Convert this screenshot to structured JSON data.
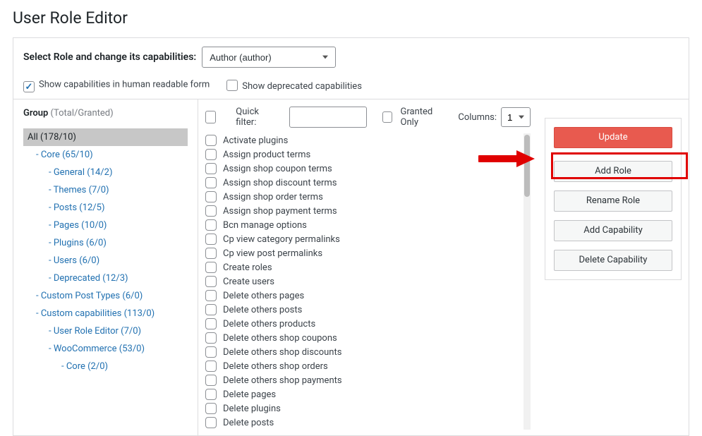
{
  "title": "User Role Editor",
  "topbar": {
    "select_label": "Select Role and change its capabilities:",
    "role_value": "Author (author)",
    "show_human": "Show capabilities in human readable form",
    "show_deprecated": "Show deprecated capabilities"
  },
  "group": {
    "heading": "Group",
    "counts_label": "(Total/Granted)",
    "items": [
      {
        "label": "All (178/10)",
        "indent": 0,
        "selected": true
      },
      {
        "label": "- Core (65/10)",
        "indent": 1
      },
      {
        "label": "- General (14/2)",
        "indent": 2
      },
      {
        "label": "- Themes (7/0)",
        "indent": 2
      },
      {
        "label": "- Posts (12/5)",
        "indent": 2
      },
      {
        "label": "- Pages (10/0)",
        "indent": 2
      },
      {
        "label": "- Plugins (6/0)",
        "indent": 2
      },
      {
        "label": "- Users (6/0)",
        "indent": 2
      },
      {
        "label": "- Deprecated (12/3)",
        "indent": 2
      },
      {
        "label": "- Custom Post Types (6/0)",
        "indent": 1
      },
      {
        "label": "- Custom capabilities (113/0)",
        "indent": 1
      },
      {
        "label": "- User Role Editor (7/0)",
        "indent": 2
      },
      {
        "label": "- WooCommerce (53/0)",
        "indent": 2
      },
      {
        "label": "- Core (2/0)",
        "indent": 3
      }
    ]
  },
  "filter": {
    "quick_filter_label": "Quick filter:",
    "granted_only": "Granted Only",
    "columns_label": "Columns:",
    "columns_value": "1"
  },
  "caps": [
    "Activate plugins",
    "Assign product terms",
    "Assign shop coupon terms",
    "Assign shop discount terms",
    "Assign shop order terms",
    "Assign shop payment terms",
    "Bcn manage options",
    "Cp view category permalinks",
    "Cp view post permalinks",
    "Create roles",
    "Create users",
    "Delete others pages",
    "Delete others posts",
    "Delete others products",
    "Delete others shop coupons",
    "Delete others shop discounts",
    "Delete others shop orders",
    "Delete others shop payments",
    "Delete pages",
    "Delete plugins",
    "Delete posts"
  ],
  "actions": {
    "update": "Update",
    "add_role": "Add Role",
    "rename_role": "Rename Role",
    "add_capability": "Add Capability",
    "delete_capability": "Delete Capability"
  }
}
